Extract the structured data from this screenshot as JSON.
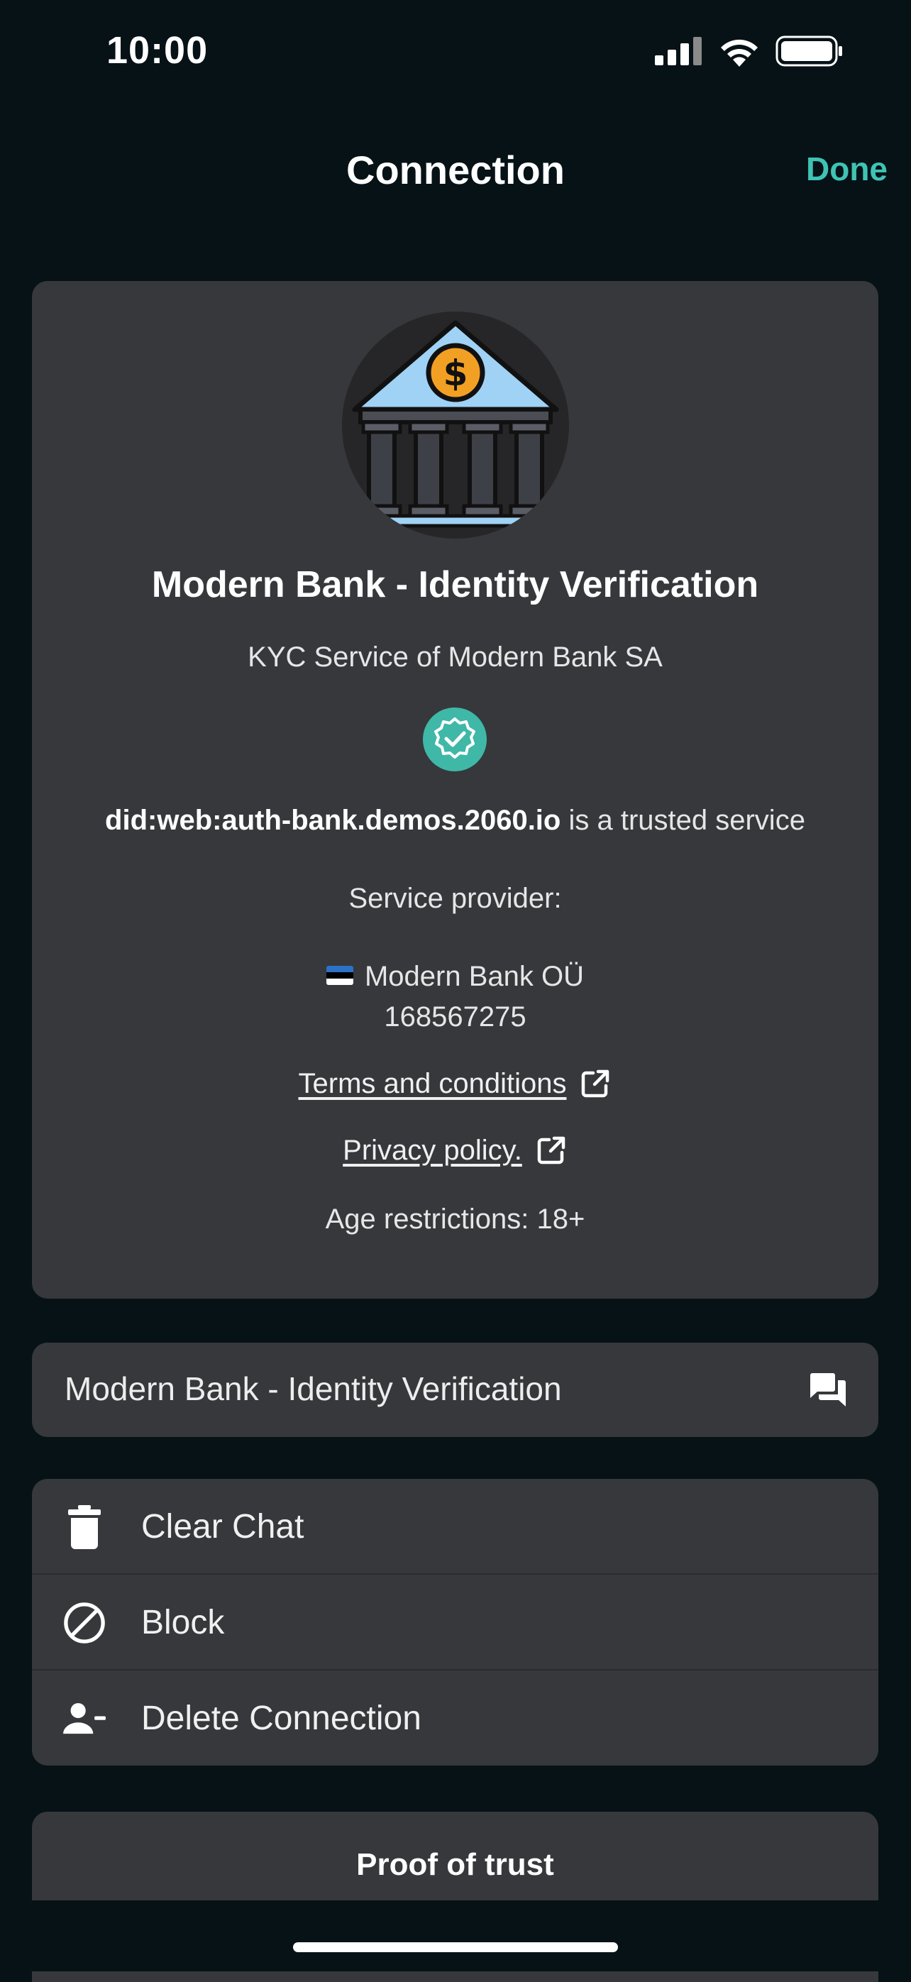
{
  "status_bar": {
    "time": "10:00"
  },
  "nav": {
    "title": "Connection",
    "done_label": "Done"
  },
  "info": {
    "title": "Modern Bank - Identity Verification",
    "subtitle": "KYC Service of Modern Bank SA",
    "did": "did:web:auth-bank.demos.2060.io",
    "trusted_suffix": "is a trusted service",
    "service_provider_label": "Service provider:",
    "provider_name": "Modern Bank OÜ",
    "provider_id": "168567275",
    "terms_label": "Terms and conditions",
    "privacy_label": "Privacy policy.",
    "age_restriction": "Age restrictions: 18+"
  },
  "chat": {
    "label": "Modern Bank - Identity Verification"
  },
  "actions": [
    {
      "label": "Clear Chat",
      "icon": "trash-icon"
    },
    {
      "label": "Block",
      "icon": "block-icon"
    },
    {
      "label": "Delete Connection",
      "icon": "remove-user-icon"
    }
  ],
  "proof": {
    "title": "Proof of trust"
  },
  "colors": {
    "accent": "#3fc3b4",
    "background": "#061216",
    "card": "#36383c"
  }
}
